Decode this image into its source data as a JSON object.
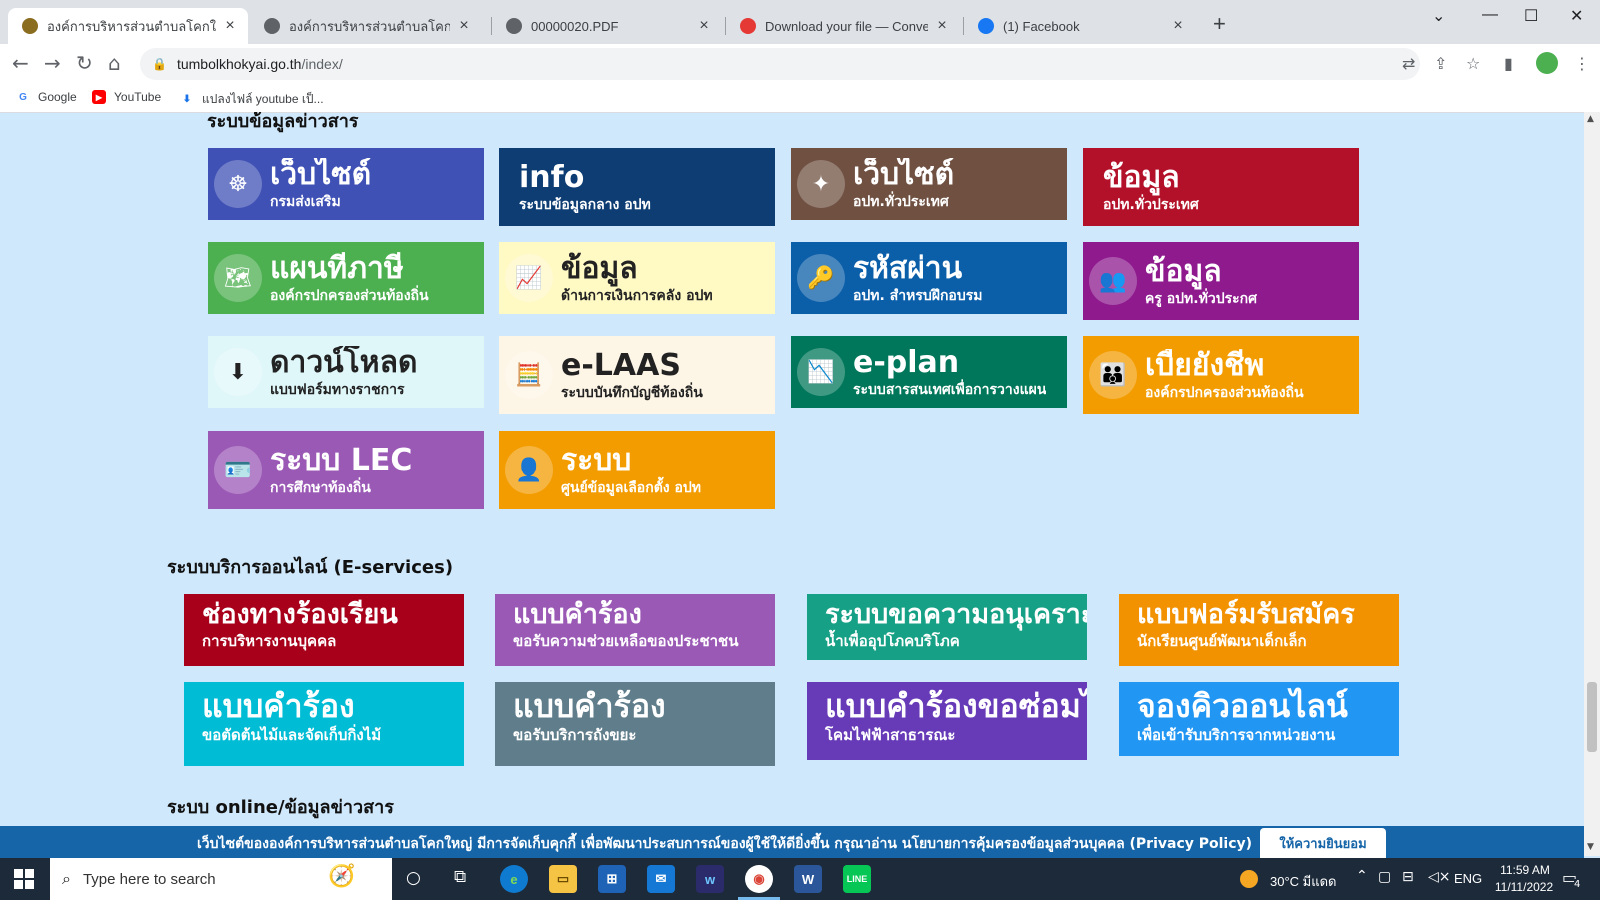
{
  "browser": {
    "tabs": [
      {
        "title": "องค์การบริหารส่วนตำบลโคกใหญ่ อำเภอ",
        "active": true,
        "fav_color": "#8a6d1f"
      },
      {
        "title": "องค์การบริหารส่วนตำบลโคกใหญ่ อำเภอ",
        "active": false,
        "fav_color": "#5f6368"
      },
      {
        "title": "00000020.PDF",
        "active": false,
        "fav_color": "#5f6368"
      },
      {
        "title": "Download your file — Convertio",
        "active": false,
        "fav_color": "#e53935"
      },
      {
        "title": "(1) Facebook",
        "active": false,
        "fav_color": "#1877f2"
      }
    ],
    "url_domain": "tumbolkhokyai.go.th",
    "url_path": "/index/",
    "bookmarks": [
      {
        "label": "Google",
        "icon": "google-icon",
        "color": "#4285f4"
      },
      {
        "label": "YouTube",
        "icon": "youtube-icon",
        "color": "#ff0000"
      },
      {
        "label": "แปลงไฟล์ youtube เป็...",
        "icon": "download-icon",
        "color": "#1a73e8"
      }
    ]
  },
  "page": {
    "section1_title": "ระบบข้อมูลข่าวสาร",
    "info_tiles": [
      {
        "title": "เว็บไซต์",
        "subtitle": "กรมส่งเสริม",
        "bg": "#3f51b5",
        "fg": "#ffffff",
        "icon": "emblem-icon",
        "glyph": "☸"
      },
      {
        "title": "info",
        "subtitle": "ระบบข้อมูลกลาง อปท",
        "bg": "#0d3d73",
        "fg": "#ffffff",
        "icon": "",
        "glyph": ""
      },
      {
        "title": "เว็บไซต์",
        "subtitle": "อปท.ทั่วประเทศ",
        "bg": "#6f5041",
        "fg": "#ffffff",
        "icon": "network-icon",
        "glyph": "✦"
      },
      {
        "title": "ข้อมูล",
        "subtitle": "อปท.ทั่วประเทศ",
        "bg": "#b3112a",
        "fg": "#ffffff",
        "icon": "",
        "glyph": ""
      },
      {
        "title": "แผนที่ภาษี",
        "subtitle": "องค์กรปกครองส่วนท้องถิ่น",
        "bg": "#4caf50",
        "fg": "#ffffff",
        "icon": "map-icon",
        "glyph": "🗺"
      },
      {
        "title": "ข้อมูล",
        "subtitle": "ด้านการเงินการคลัง อปท",
        "bg": "#fff9c4",
        "fg": "#222222",
        "icon": "finance-icon",
        "glyph": "📈"
      },
      {
        "title": "รหัสผ่าน",
        "subtitle": "อปท. สำหรบฝึกอบรม",
        "bg": "#0b5ea8",
        "fg": "#ffffff",
        "icon": "key-icon",
        "glyph": "🔑"
      },
      {
        "title": "ข้อมูล",
        "subtitle": "ครู อปท.ทั่วประกศ",
        "bg": "#8e1a8e",
        "fg": "#ffffff",
        "icon": "teachers-icon",
        "glyph": "👥"
      },
      {
        "title": "ดาวน์โหลด",
        "subtitle": "แบบฟอร์มทางราชการ",
        "bg": "#e0f7fa",
        "fg": "#222222",
        "icon": "file-download-icon",
        "glyph": "⬇"
      },
      {
        "title": "e-LAAS",
        "subtitle": "ระบบบันทึกบัญชีท้องถิ่น",
        "bg": "#fdf5e6",
        "fg": "#222222",
        "icon": "accounting-icon",
        "glyph": "🧮"
      },
      {
        "title": "e-plan",
        "subtitle": "ระบบสารสนเทศเพื่อการวางแผน",
        "bg": "#00775a",
        "fg": "#ffffff",
        "icon": "chart-icon",
        "glyph": "📉"
      },
      {
        "title": "เบี้ยยังชีพ",
        "subtitle": "องค์กรปกครองส่วนท้องถิ่น",
        "bg": "#f39c00",
        "fg": "#ffffff",
        "icon": "family-icon",
        "glyph": "👪"
      },
      {
        "title": "ระบบ LEC",
        "subtitle": "การศึกษาท้องถิ่น",
        "bg": "#9b59b6",
        "fg": "#ffffff",
        "icon": "id-card-icon",
        "glyph": "🪪"
      },
      {
        "title": "ระบบ",
        "subtitle": "ศูนย์ข้อมูลเลือกตั้ง อปท",
        "bg": "#f39c00",
        "fg": "#ffffff",
        "icon": "person-icon",
        "glyph": "👤"
      }
    ],
    "section2_title": "ระบบบริการออนไลน์ (E-services)",
    "eservices": [
      {
        "title": "ช่องทางร้องเรียน",
        "subtitle": "การบริหารงานบุคคล",
        "bg": "#a8001a"
      },
      {
        "title": "แบบคำร้อง",
        "subtitle": "ขอรับความช่วยเหลือของประชาชน",
        "bg": "#9b59b6"
      },
      {
        "title": "ระบบขอความอนุเคราะห์",
        "subtitle": "น้ำเพื่ออุปโภคบริโภค",
        "bg": "#16a085"
      },
      {
        "title": "แบบฟอร์มรับสมัคร",
        "subtitle": "นักเรียนศูนย์พัฒนาเด็กเล็ก",
        "bg": "#f39200"
      },
      {
        "title": "แบบคำร้อง",
        "subtitle": "ขอตัดต้นไม้และจัดเก็บกิ่งไม้",
        "bg": "#00bcd4"
      },
      {
        "title": "แบบคำร้อง",
        "subtitle": "ขอรับบริการถังขยะ",
        "bg": "#607d8b"
      },
      {
        "title": "แบบคำร้องขอซ่อมไฟฟ้า",
        "subtitle": "โคมไฟฟ้าสาธารณะ",
        "bg": "#673ab7"
      },
      {
        "title": "จองคิวออนไลน์",
        "subtitle": "เพื่อเข้ารับบริการจากหน่วยงาน",
        "bg": "#2196f3"
      }
    ],
    "section3_title": "ระบบ online/ข้อมูลข่าวสาร"
  },
  "cookie": {
    "message": "เว็บไซต์ขององค์การบริหารส่วนตำบลโคกใหญ่ มีการจัดเก็บคุกกี้ เพื่อพัฒนาประสบการณ์ของผู้ใช้ให้ดียิ่งขึ้น กรุณาอ่าน นโยบายการคุ้มครองข้อมูลส่วนบุคคล (Privacy Policy)",
    "accept": "ให้ความยินยอม"
  },
  "taskbar": {
    "search_placeholder": "Type here to search",
    "weather": "30°C มีแดด",
    "lang": "ENG",
    "time": "11:59 AM",
    "date": "11/11/2022",
    "notifications": "4"
  }
}
